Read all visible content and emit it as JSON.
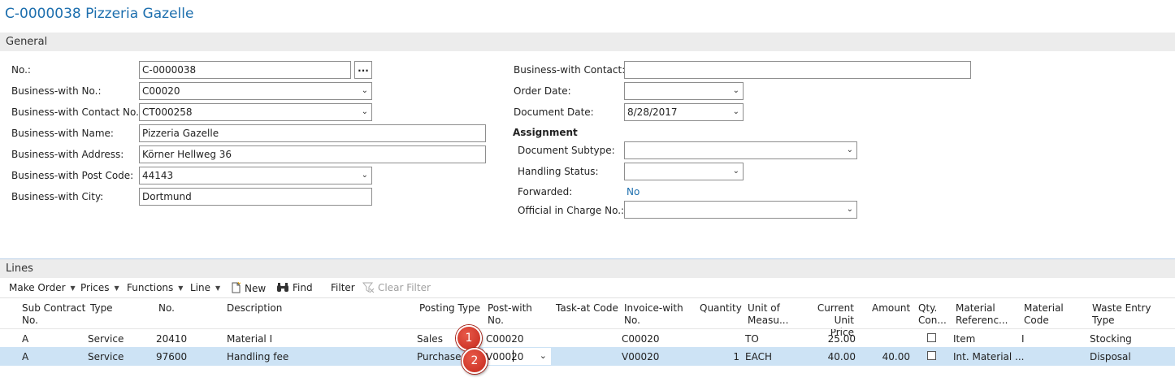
{
  "page_title": "C-0000038 Pizzeria Gazelle",
  "general": {
    "section_label": "General",
    "left_fields": [
      {
        "label": "No.:",
        "value": "C-0000038"
      },
      {
        "label": "Business-with No.:",
        "value": "C00020"
      },
      {
        "label": "Business-with Contact No.:",
        "value": "CT000258"
      },
      {
        "label": "Business-with Name:",
        "value": "Pizzeria Gazelle"
      },
      {
        "label": "Business-with Address:",
        "value": "Körner Hellweg 36"
      },
      {
        "label": "Business-with Post Code:",
        "value": "44143"
      },
      {
        "label": "Business-with City:",
        "value": "Dortmund"
      }
    ],
    "assist_button": "...",
    "right_fields": [
      {
        "label": "Business-with Contact:",
        "value": ""
      },
      {
        "label": "Order Date:",
        "value": ""
      },
      {
        "label": "Document Date:",
        "value": "8/28/2017"
      }
    ],
    "assignment_heading": "Assignment",
    "assignment_fields": [
      {
        "label": "Document Subtype:",
        "value": ""
      },
      {
        "label": "Handling Status:",
        "value": ""
      },
      {
        "label": "Forwarded:",
        "value": "No"
      },
      {
        "label": "Official in Charge No.:",
        "value": ""
      }
    ]
  },
  "lines": {
    "section_label": "Lines",
    "toolbar": {
      "make_order": "Make Order",
      "prices": "Prices",
      "functions": "Functions",
      "line": "Line",
      "new": "New",
      "find": "Find",
      "filter": "Filter",
      "clear_filter": "Clear Filter"
    },
    "columns": {
      "sub_contract_no": [
        "Sub Contract",
        "No."
      ],
      "type": "Type",
      "no": "No.",
      "description": "Description",
      "posting_type": "Posting Type",
      "post_with_no": [
        "Post-with",
        "No."
      ],
      "task_at_code": "Task-at Code",
      "invoice_with_no": [
        "Invoice-with",
        "No."
      ],
      "quantity": "Quantity",
      "unit_of_measure": [
        "Unit of",
        "Measu..."
      ],
      "current_unit_price": [
        "Current Unit",
        "Price"
      ],
      "amount": "Amount",
      "qty_con": [
        "Qty.",
        "Con..."
      ],
      "material_reference": [
        "Material",
        "Referenc..."
      ],
      "material_code": [
        "Material",
        "Code"
      ],
      "waste_entry_type": [
        "Waste Entry",
        "Type"
      ]
    },
    "rows": [
      {
        "sub_contract": "A",
        "type": "Service",
        "no": "20410",
        "description": "Material I",
        "posting_type": "Sales",
        "post_with_no": "C00020",
        "task_at_code": "",
        "invoice_with_no": "C00020",
        "quantity": "",
        "unit": "TO",
        "unit_price": "25.00",
        "amount": "",
        "qty_con": false,
        "material_reference": "Item",
        "material_code": "I",
        "waste_entry_type": "Stocking"
      },
      {
        "sub_contract": "A",
        "type": "Service",
        "no": "97600",
        "description": "Handling fee",
        "posting_type": "Purchase",
        "post_with_no": "V00020",
        "task_at_code": "",
        "invoice_with_no": "V00020",
        "quantity": "1",
        "unit": "EACH",
        "unit_price": "40.00",
        "amount": "40.00",
        "qty_con": false,
        "material_reference": "Int. Material ...",
        "material_code": "",
        "waste_entry_type": "Disposal"
      }
    ],
    "callouts": [
      "1",
      "2"
    ]
  },
  "colors": {
    "title": "#1d6fae",
    "section_bar": "#ececec",
    "selected_row": "#cde3f5",
    "callout": "#c4281c",
    "link": "#1d6fae"
  }
}
